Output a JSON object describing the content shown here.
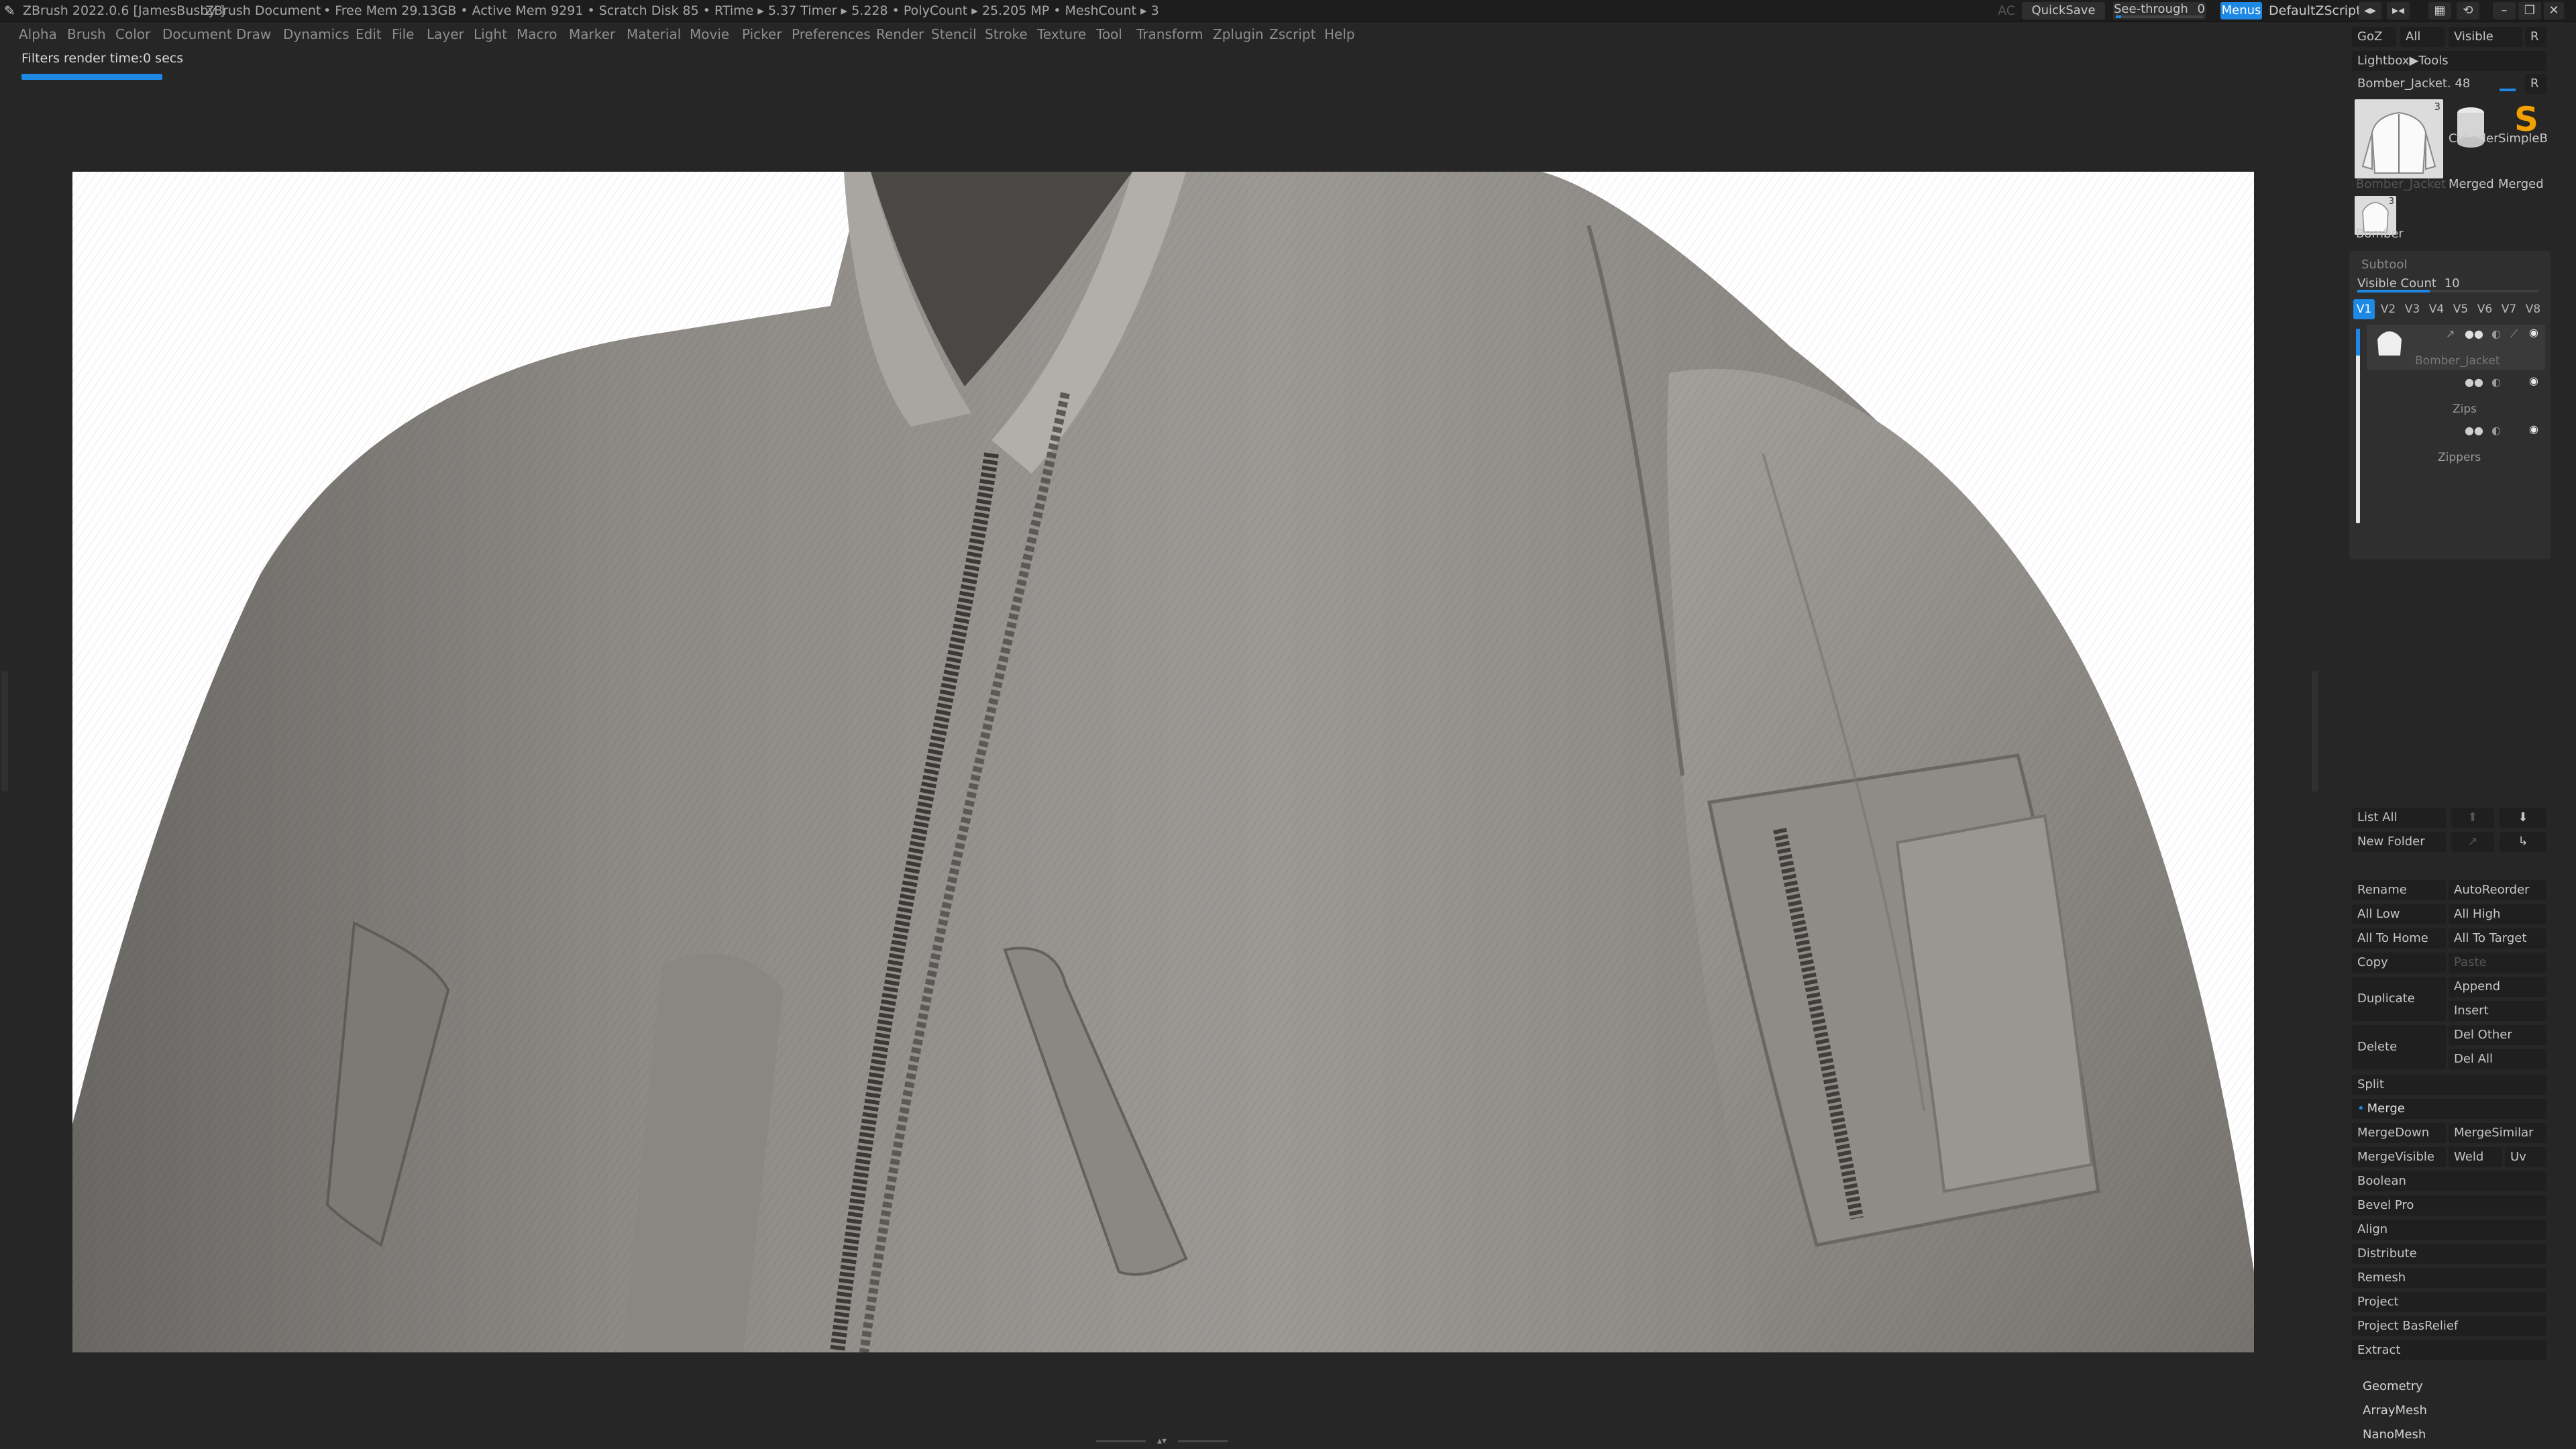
{
  "titlebar": {
    "app": "ZBrush 2022.0.6 [JamesBusby ]",
    "document": "ZBrush Document",
    "stats": "• Free Mem 29.13GB • Active Mem 9291 • Scratch Disk 85 •  RTime ▸ 5.37 Timer ▸ 5.228 • PolyCount ▸ 25.205 MP • MeshCount ▸ 3",
    "quicksave": "QuickSave",
    "seethrough": "See-through",
    "seethrough_value": "0",
    "seethrough_level": 0,
    "menus": "Menus",
    "script": "DefaultZScript",
    "ac": "AC"
  },
  "menu": [
    "Alpha",
    "Brush",
    "Color",
    "Document",
    "Draw",
    "Dynamics",
    "Edit",
    "File",
    "Layer",
    "Light",
    "Macro",
    "Marker",
    "Material",
    "Movie",
    "Picker",
    "Preferences",
    "Render",
    "Stencil",
    "Stroke",
    "Texture",
    "Tool",
    "Transform",
    "Zplugin",
    "Zscript",
    "Help"
  ],
  "status": {
    "message": "Filters render time:0 secs"
  },
  "tool": {
    "goz": "GoZ",
    "all": "All",
    "visible": "Visible",
    "r": "R",
    "lightbox": "Lightbox▶Tools",
    "current": "Bomber_Jacket. 48",
    "current_r": "R",
    "thumbs": [
      {
        "label": "Bomber_Jacket",
        "count": "3"
      },
      {
        "label": "Cylinder"
      },
      {
        "label": "SimpleB"
      },
      {
        "label": "Merged"
      },
      {
        "label": "Merged"
      },
      {
        "label": "Bomber",
        "count": "3"
      }
    ]
  },
  "subtool": {
    "title": "Subtool",
    "visible_count_label": "Visible Count",
    "visible_count": "10",
    "visible_count_level": 0.4,
    "versions": [
      "V1",
      "V2",
      "V3",
      "V4",
      "V5",
      "V6",
      "V7",
      "V8"
    ],
    "items": [
      "Bomber_Jacket",
      "Zips",
      "Zippers"
    ],
    "list_all": "List All",
    "new_folder": "New Folder"
  },
  "actions": {
    "rename": "Rename",
    "autoreorder": "AutoReorder",
    "all_low": "All Low",
    "all_high": "All High",
    "all_to_home": "All To Home",
    "all_to_target": "All To Target",
    "copy": "Copy",
    "paste": "Paste",
    "duplicate": "Duplicate",
    "append": "Append",
    "insert": "Insert",
    "delete": "Delete",
    "del_other": "Del Other",
    "del_all": "Del All",
    "split": "Split",
    "merge": "Merge",
    "mergedown": "MergeDown",
    "mergesimilar": "MergeSimilar",
    "mergevisible": "MergeVisible",
    "weld": "Weld",
    "uv": "Uv",
    "boolean": "Boolean",
    "bevel_pro": "Bevel Pro",
    "align": "Align",
    "distribute": "Distribute",
    "remesh": "Remesh",
    "project": "Project",
    "project_basrelief": "Project BasRelief",
    "extract": "Extract"
  },
  "sections": {
    "geometry": "Geometry",
    "arraymesh": "ArrayMesh",
    "nanomesh": "NanoMesh"
  }
}
